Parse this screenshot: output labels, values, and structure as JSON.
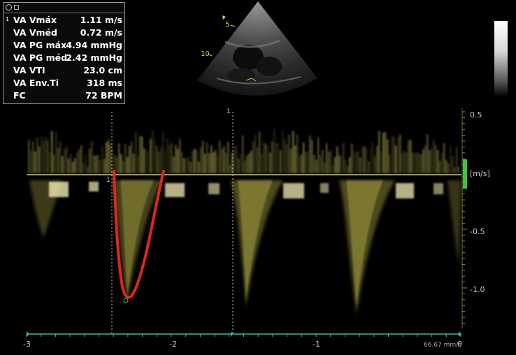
{
  "measurements": {
    "index": "1",
    "rows": [
      {
        "label": "VA Vmáx",
        "value": "1.11 m/s"
      },
      {
        "label": "VA Vméd",
        "value": "0.72 m/s"
      },
      {
        "label": "VA PG máx",
        "value": "4.94 mmHg"
      },
      {
        "label": "VA PG méd",
        "value": "2.42 mmHg"
      },
      {
        "label": "VA VTI",
        "value": "23.0 cm"
      },
      {
        "label": "VA Env.Ti",
        "value": "318 ms"
      },
      {
        "label": "FC",
        "value": "72 BPM"
      }
    ]
  },
  "sector": {
    "depth_labels": [
      "5",
      "10"
    ]
  },
  "doppler": {
    "unit_label": "[m/s]",
    "velocity_ticks": [
      "0.5",
      "-0.5",
      "-1.0"
    ],
    "time_ticks": [
      "-3",
      "-2",
      "-1",
      "0"
    ],
    "sweep_speed": "66.67 mm/s",
    "cursor_label": "1",
    "trace_label": "1"
  },
  "colors": {
    "spectral": "#d8d060",
    "trace": "#e0261e",
    "baseline": "#c8c890",
    "timeline": "#3fb8a0",
    "marker": "#3cc83c"
  }
}
